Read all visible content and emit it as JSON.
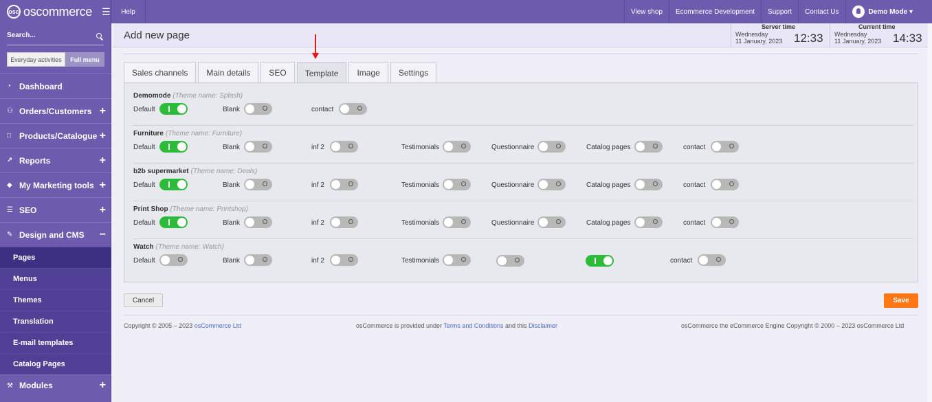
{
  "brand": {
    "logo_text": "oscommerce",
    "logo_mark": "osc"
  },
  "sidebar": {
    "search_label": "Search...",
    "mode_toggle": {
      "left": "Everyday activities",
      "right": "Full menu"
    },
    "items": [
      {
        "label": "Dashboard",
        "icon": "dashboard-icon",
        "glyph": "◔",
        "expand": ""
      },
      {
        "label": "Orders/Customers",
        "icon": "users-icon",
        "glyph": "⚇",
        "expand": "+"
      },
      {
        "label": "Products/Catalogue",
        "icon": "folder-icon",
        "glyph": "□",
        "expand": "+"
      },
      {
        "label": "Reports",
        "icon": "line-chart-icon",
        "glyph": "↗",
        "expand": "+"
      },
      {
        "label": "My Marketing tools",
        "icon": "tag-icon",
        "glyph": "◆",
        "expand": "+"
      },
      {
        "label": "SEO",
        "icon": "sitemap-icon",
        "glyph": "☰",
        "expand": "+"
      },
      {
        "label": "Design and CMS",
        "icon": "brush-icon",
        "glyph": "✎",
        "expand": "−"
      }
    ],
    "subitems": [
      "Pages",
      "Menus",
      "Themes",
      "Translation",
      "E-mail templates",
      "Catalog Pages"
    ],
    "modules": {
      "label": "Modules",
      "glyph": "⚒",
      "expand": "+"
    }
  },
  "topbar": {
    "help": "Help",
    "links": [
      "View shop",
      "Ecommerce Development",
      "Support",
      "Contact Us"
    ],
    "user": "Demo Mode ▾"
  },
  "header": {
    "title": "Add new page",
    "server_time": {
      "label": "Server time",
      "day": "Wednesday",
      "date": "11 January, 2023",
      "clock": "12:33"
    },
    "current_time": {
      "label": "Current time",
      "day": "Wednesday",
      "date": "11 January, 2023",
      "clock": "14:33"
    }
  },
  "tabs": [
    "Sales channels",
    "Main details",
    "SEO",
    "Template",
    "Image",
    "Settings"
  ],
  "active_tab": "Template",
  "themes": [
    {
      "name": "Demomode",
      "theme_label": "(Theme name: Splash)",
      "options": [
        {
          "label": "Default",
          "on": true
        },
        {
          "label": "Blank",
          "on": false
        },
        {
          "label": "contact",
          "on": false
        }
      ]
    },
    {
      "name": "Furniture",
      "theme_label": "(Theme name: Furniture)",
      "options": [
        {
          "label": "Default",
          "on": true
        },
        {
          "label": "Blank",
          "on": false
        },
        {
          "label": "inf 2",
          "on": false
        },
        {
          "label": "Testimonials",
          "on": false
        },
        {
          "label": "Questionnaire",
          "on": false
        },
        {
          "label": "Catalog pages",
          "on": false
        },
        {
          "label": "contact",
          "on": false
        }
      ]
    },
    {
      "name": "b2b supermarket",
      "theme_label": "(Theme name: Deals)",
      "options": [
        {
          "label": "Default",
          "on": true
        },
        {
          "label": "Blank",
          "on": false
        },
        {
          "label": "inf 2",
          "on": false
        },
        {
          "label": "Testimonials",
          "on": false
        },
        {
          "label": "Questionnaire",
          "on": false
        },
        {
          "label": "Catalog pages",
          "on": false
        },
        {
          "label": "contact",
          "on": false
        }
      ]
    },
    {
      "name": "Print Shop",
      "theme_label": "(Theme name: Printshop)",
      "options": [
        {
          "label": "Default",
          "on": true
        },
        {
          "label": "Blank",
          "on": false
        },
        {
          "label": "inf 2",
          "on": false
        },
        {
          "label": "Testimonials",
          "on": false
        },
        {
          "label": "Questionnaire",
          "on": false
        },
        {
          "label": "Catalog pages",
          "on": false
        },
        {
          "label": "contact",
          "on": false
        }
      ]
    },
    {
      "name": "Watch",
      "theme_label": "(Theme name: Watch)",
      "options": [
        {
          "label": "Default",
          "on": false
        },
        {
          "label": "Blank",
          "on": false
        },
        {
          "label": "inf 2",
          "on": false
        },
        {
          "label": "Testimonials",
          "on": false
        },
        {
          "label": "",
          "on": false
        },
        {
          "label": "",
          "on": true
        },
        {
          "label": "contact",
          "on": false
        }
      ]
    }
  ],
  "buttons": {
    "cancel": "Cancel",
    "save": "Save"
  },
  "footer": {
    "left_text": "Copyright © 2005 – 2023 ",
    "left_link": "osCommerce Ltd",
    "mid_text1": "osCommerce is provided under ",
    "mid_link1": "Terms and Conditions",
    "mid_text2": " and this ",
    "mid_link2": "Disclaimer",
    "right_text": "osCommerce the eCommerce Engine Copyright © 2000 – 2023 osCommerce Ltd"
  },
  "colors": {
    "sidebar": "#6d5cae",
    "switch_on": "#2dbb3a",
    "switch_off": "#b8b8b8",
    "save": "#ff7714",
    "annotation_arrow": "#e81313"
  }
}
